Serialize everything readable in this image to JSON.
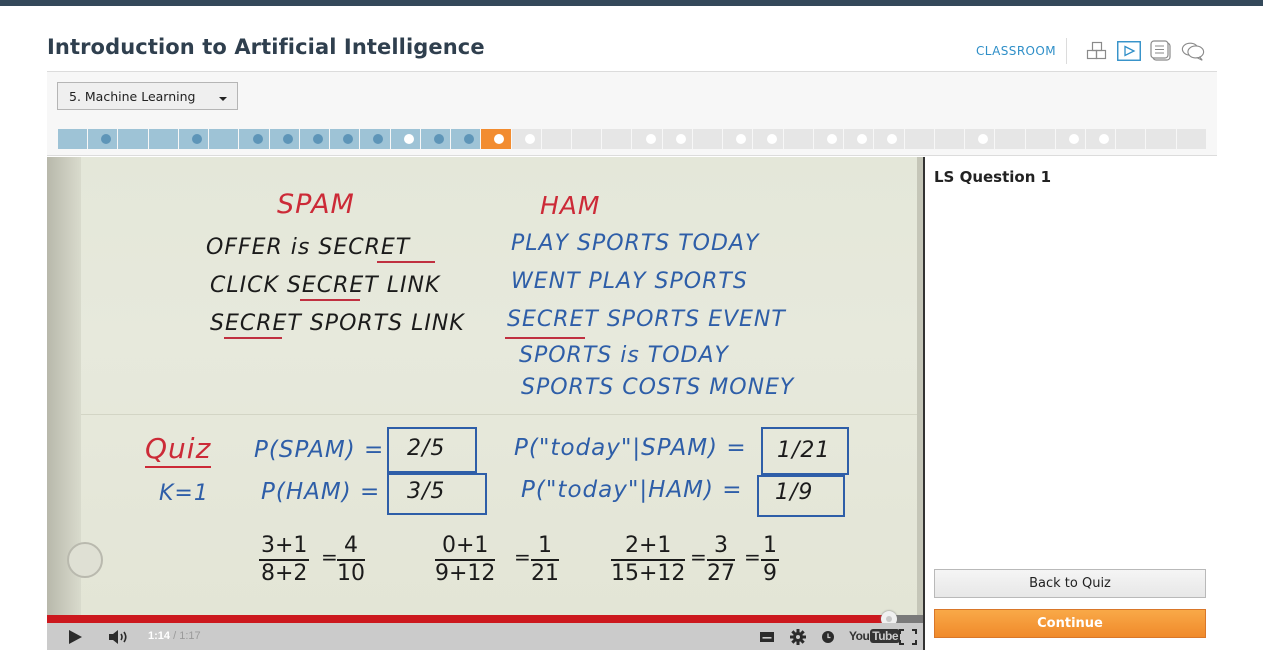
{
  "header": {
    "course_title": "Introduction to Artificial Intelligence",
    "nav": {
      "classroom_label": "CLASSROOM",
      "icons": [
        "course-map-icon",
        "video-play-icon",
        "notes-icon",
        "discussion-icon"
      ],
      "active_icon": "video-play-icon",
      "accent_color": "#2f8fc8"
    }
  },
  "lesson_selector": {
    "selected": "5. Machine Learning"
  },
  "lesson_progress": {
    "colors": {
      "completed": "#9ec3d6",
      "current": "#f28c30",
      "upcoming": "#e6e6e6"
    },
    "segments": [
      {
        "state": "done",
        "dot": "none"
      },
      {
        "state": "done",
        "dot": "blue"
      },
      {
        "state": "done",
        "dot": "none"
      },
      {
        "state": "done",
        "dot": "none"
      },
      {
        "state": "done",
        "dot": "blue"
      },
      {
        "state": "done",
        "dot": "none"
      },
      {
        "state": "done",
        "dot": "blue"
      },
      {
        "state": "done",
        "dot": "blue"
      },
      {
        "state": "done",
        "dot": "blue"
      },
      {
        "state": "done",
        "dot": "blue"
      },
      {
        "state": "done",
        "dot": "blue"
      },
      {
        "state": "done",
        "dot": "white"
      },
      {
        "state": "done",
        "dot": "blue"
      },
      {
        "state": "done",
        "dot": "blue"
      },
      {
        "state": "current",
        "dot": "white"
      },
      {
        "state": "upcoming",
        "dot": "white"
      },
      {
        "state": "upcoming",
        "dot": "none"
      },
      {
        "state": "upcoming",
        "dot": "none"
      },
      {
        "state": "upcoming",
        "dot": "none"
      },
      {
        "state": "upcoming",
        "dot": "white"
      },
      {
        "state": "upcoming",
        "dot": "white"
      },
      {
        "state": "upcoming",
        "dot": "none"
      },
      {
        "state": "upcoming",
        "dot": "white"
      },
      {
        "state": "upcoming",
        "dot": "white"
      },
      {
        "state": "upcoming",
        "dot": "none"
      },
      {
        "state": "upcoming",
        "dot": "white"
      },
      {
        "state": "upcoming",
        "dot": "white"
      },
      {
        "state": "upcoming",
        "dot": "white"
      },
      {
        "state": "upcoming",
        "dot": "none"
      },
      {
        "state": "upcoming",
        "dot": "none"
      },
      {
        "state": "upcoming",
        "dot": "white"
      },
      {
        "state": "upcoming",
        "dot": "none"
      },
      {
        "state": "upcoming",
        "dot": "none"
      },
      {
        "state": "upcoming",
        "dot": "white"
      },
      {
        "state": "upcoming",
        "dot": "white"
      },
      {
        "state": "upcoming",
        "dot": "none"
      },
      {
        "state": "upcoming",
        "dot": "none"
      },
      {
        "state": "upcoming",
        "dot": "none"
      }
    ]
  },
  "video": {
    "whiteboard": {
      "spam_heading": "SPAM",
      "ham_heading": "HAM",
      "spam_lines": [
        "OFFER is SECRET",
        "CLICK SECRET LINK",
        "SECRET SPORTS LINK"
      ],
      "ham_lines": [
        "PLAY SPORTS TODAY",
        "WENT PLAY SPORTS",
        "SECRET SPORTS EVENT",
        "SPORTS is TODAY",
        "SPORTS COSTS MONEY"
      ],
      "quiz_label": "Quiz",
      "k_label": "K=1",
      "p_spam_label": "P(SPAM) =",
      "p_spam_value": "2/5",
      "p_ham_label": "P(HAM) =",
      "p_ham_value": "3/5",
      "p_today_spam_label": "P(\"today\"|SPAM) =",
      "p_today_spam_value": "1/21",
      "p_today_ham_label": "P(\"today\"|HAM) =",
      "p_today_ham_value": "1/9",
      "calc1": {
        "num": "3+1",
        "den": "8+2",
        "res_num": "4",
        "res_den": "10"
      },
      "calc2": {
        "num": "0+1",
        "den": "9+12",
        "res_num": "1",
        "res_den": "21"
      },
      "calc3": {
        "num": "2+1",
        "den": "15+12",
        "res_num": "3",
        "res_den": "27",
        "res2_num": "1",
        "res2_den": "9"
      }
    },
    "player": {
      "current_time": "1:14",
      "duration": "1:17",
      "time_separator": " / ",
      "played_fraction": 0.961,
      "progress_color": "#cc181e",
      "logo_you": "You",
      "logo_tube": "Tube"
    }
  },
  "side_panel": {
    "question_title": "LS Question 1",
    "back_button": "Back to Quiz",
    "continue_button": "Continue",
    "continue_color": "#f28c30"
  }
}
